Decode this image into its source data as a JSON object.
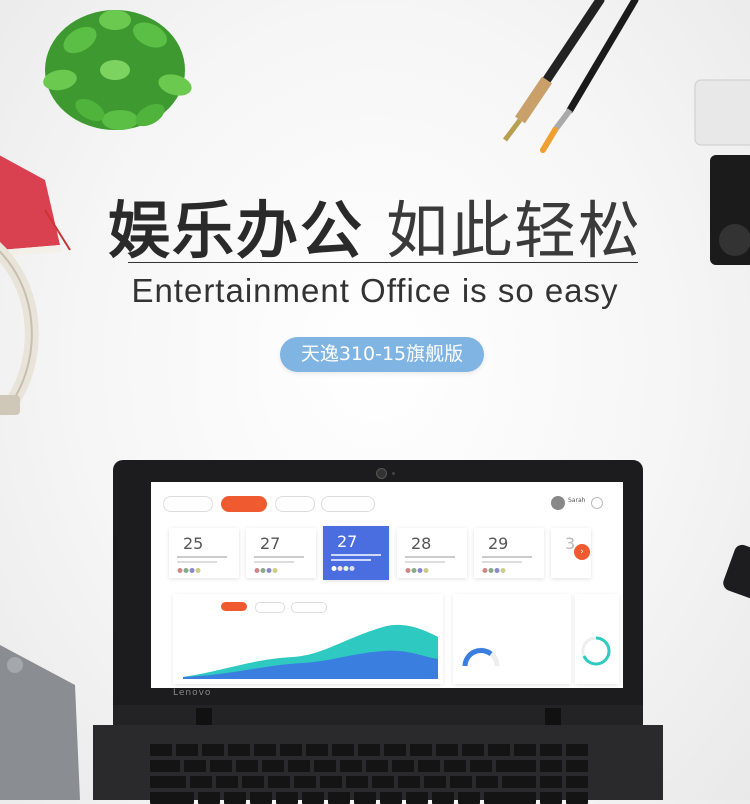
{
  "headline": {
    "bold_part": "娱乐办公",
    "light_part": "如此轻松"
  },
  "subtitle": "Entertainment Office is so easy",
  "badge": "天逸310-15旗舰版",
  "laptop": {
    "brand": "Lenovo",
    "screen": {
      "profile_name": "Sarah",
      "cards": [
        {
          "day": "25"
        },
        {
          "day": "27"
        },
        {
          "day": "27"
        },
        {
          "day": "28"
        },
        {
          "day": "29"
        },
        {
          "day": "3"
        }
      ]
    }
  },
  "colors": {
    "badge": "#7fb4e3",
    "accent": "#f05a30",
    "highlight_card": "#4a6ee0",
    "chart_teal": "#2ec9c0",
    "chart_blue": "#3a7fe0"
  }
}
